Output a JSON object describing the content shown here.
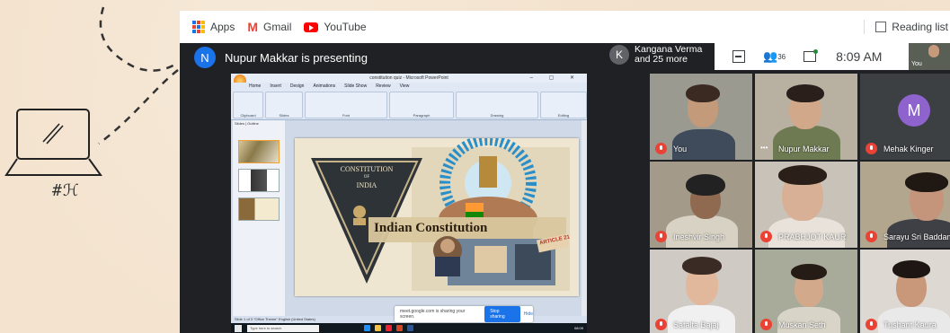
{
  "background": {
    "doodle_caption": "#ℋ"
  },
  "bookmarks": {
    "items": [
      {
        "label": "Apps",
        "icon": "apps-grid-icon"
      },
      {
        "label": "Gmail",
        "icon": "gmail-icon"
      },
      {
        "label": "YouTube",
        "icon": "youtube-icon"
      }
    ],
    "reading_list": "Reading list"
  },
  "meeting": {
    "presenter_initial": "N",
    "presenter_text": "Nupur Makkar is presenting",
    "participants_initial": "K",
    "participants_line1": "Kangana Verma",
    "participants_line2": "and 25 more",
    "people_count": "36",
    "time": "8:09 AM",
    "self_label": "You",
    "accent": "#1a73e8",
    "mute_color": "#ea4335"
  },
  "presentation": {
    "window_title": "constitution quiz - Microsoft PowerPoint",
    "ribbon_tabs": [
      "Home",
      "Insert",
      "Design",
      "Animations",
      "Slide Show",
      "Review",
      "View"
    ],
    "ribbon_groups": [
      "Clipboard",
      "Slides",
      "Font",
      "Paragraph",
      "Drawing",
      "Editing"
    ],
    "thumb_tabs": "Slides | Outline",
    "status": "Slide 1 of 3   \"Office Theme\"   English (United States)",
    "taskbar_search": "Type here to search",
    "taskbar_time": "08:09",
    "slide": {
      "triangle_title_1": "CONSTITUTION",
      "triangle_title_2": "OF",
      "triangle_title_3": "INDIA",
      "banner": "Indian Constitution",
      "tag": "ARTICLE 21"
    },
    "share_message": "meet.google.com is sharing your screen.",
    "stop_sharing": "Stop sharing",
    "hide": "Hide"
  },
  "tiles": [
    {
      "name": "You",
      "style": "t1"
    },
    {
      "name": "Nupur Makkar",
      "style": "t2"
    },
    {
      "name": "Mehak Kinger",
      "style": "t3",
      "avatar": "M"
    },
    {
      "name": "Ineshvir Singh",
      "style": "t4"
    },
    {
      "name": "PRABHJOT KAUR",
      "style": "t5"
    },
    {
      "name": "Sarayu Sri Baddam",
      "style": "t6"
    },
    {
      "name": "Safalta Bajaj",
      "style": "t7"
    },
    {
      "name": "Muskan Seth",
      "style": "t8"
    },
    {
      "name": "Tushant Kaura",
      "style": "t9"
    }
  ]
}
